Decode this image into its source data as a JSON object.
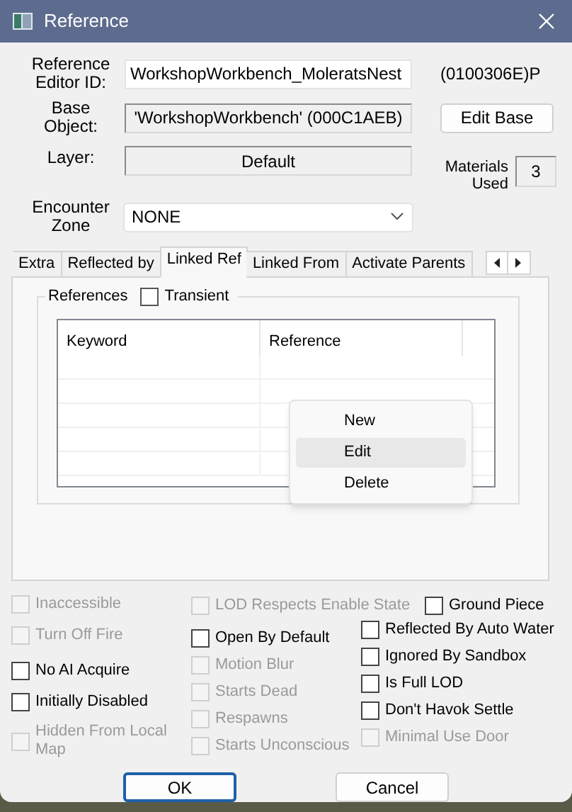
{
  "window": {
    "title": "Reference"
  },
  "editor_id": {
    "label": "Reference Editor ID:",
    "value": "WorkshopWorkbench_MoleratsNest",
    "form_id": "(0100306E)P"
  },
  "base_object": {
    "label": "Base Object:",
    "value": "'WorkshopWorkbench' (000C1AEB)",
    "disabled": true,
    "button": "Edit Base"
  },
  "layer": {
    "label": "Layer:",
    "value": "Default",
    "disabled": true
  },
  "materials_used": {
    "label": "Materials Used",
    "value": "3",
    "disabled": true
  },
  "encounter_zone": {
    "label": "Encounter Zone",
    "value": "NONE"
  },
  "tabs": [
    {
      "label": "Extra",
      "selected": false
    },
    {
      "label": "Reflected by",
      "selected": false
    },
    {
      "label": "Linked Ref",
      "selected": true
    },
    {
      "label": "Linked From",
      "selected": false
    },
    {
      "label": "Activate Parents",
      "selected": false
    }
  ],
  "references": {
    "label": "References",
    "transient": {
      "label": "Transient",
      "checked": false
    },
    "columns": [
      "Keyword",
      "Reference"
    ]
  },
  "context_menu": [
    {
      "label": "New",
      "selected": false
    },
    {
      "label": "Edit",
      "selected": true
    },
    {
      "label": "Delete",
      "selected": false
    }
  ],
  "flags": {
    "column_1": [
      {
        "label": "Inaccessible",
        "checked": false,
        "disabled": true
      },
      {
        "label": "Turn Off Fire",
        "checked": false,
        "disabled": true
      },
      {
        "label": "No AI Acquire",
        "checked": false,
        "disabled": false
      },
      {
        "label": "Initially Disabled",
        "checked": false,
        "disabled": false
      },
      {
        "label": "Hidden From Local Map",
        "checked": false,
        "disabled": true
      }
    ],
    "column_2": [
      {
        "label": "LOD Respects Enable State",
        "checked": false,
        "disabled": true
      },
      {
        "label": "Open By Default",
        "checked": false,
        "disabled": false
      },
      {
        "label": "Motion Blur",
        "checked": false,
        "disabled": true
      },
      {
        "label": "Starts Dead",
        "checked": false,
        "disabled": true
      },
      {
        "label": "Respawns",
        "checked": false,
        "disabled": true
      },
      {
        "label": "Starts Unconscious",
        "checked": false,
        "disabled": true
      }
    ],
    "column_3": [
      {
        "label": "Ground Piece",
        "checked": false,
        "disabled": false
      },
      {
        "label": "Reflected By Auto Water",
        "checked": false,
        "disabled": false
      },
      {
        "label": "Ignored By Sandbox",
        "checked": false,
        "disabled": false
      },
      {
        "label": "Is Full LOD",
        "checked": false,
        "disabled": false
      },
      {
        "label": "Don't Havok Settle",
        "checked": false,
        "disabled": false
      },
      {
        "label": "Minimal Use Door",
        "checked": false,
        "disabled": true
      }
    ]
  },
  "buttons": [
    {
      "label": "OK",
      "focused": true
    },
    {
      "label": "Cancel",
      "focused": false
    }
  ]
}
